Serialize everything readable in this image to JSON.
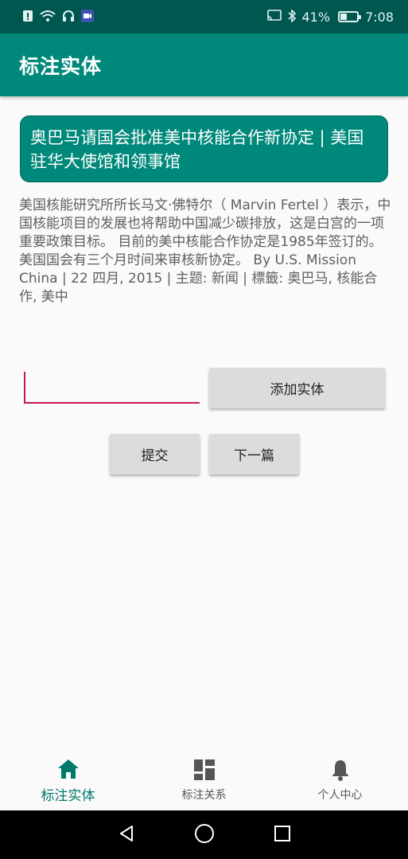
{
  "status_bar": {
    "battery_percent_text": "41%",
    "battery_level": 0.41,
    "time": "7:08"
  },
  "app_bar": {
    "title": "标注实体"
  },
  "article": {
    "title": "奥巴马请国会批准美中核能合作新协定 | 美国驻华大使馆和领事馆",
    "body": " 美国核能研究所所长马文·佛特尔（ Marvin Fertel ）表示，中国核能项目的发展也将帮助中国减少碳排放，这是白宫的一项重要政策目标。 目前的美中核能合作协定是1985年签订的。美国国会有三个月时间来审核新协定。 By U.S. Mission China | 22 四月, 2015 | 主题: 新闻 | 標籤: 奥巴马, 核能合作, 美中"
  },
  "entity_input": {
    "value": "",
    "placeholder": ""
  },
  "buttons": {
    "add_entity": "添加实体",
    "submit": "提交",
    "next": "下一篇"
  },
  "bottom_nav": {
    "items": [
      {
        "label": "标注实体",
        "icon": "home-icon",
        "active": true
      },
      {
        "label": "标注关系",
        "icon": "dashboard-icon",
        "active": false
      },
      {
        "label": "个人中心",
        "icon": "bell-icon",
        "active": false
      }
    ]
  },
  "colors": {
    "status_bar": "#00574f",
    "primary": "#00897b",
    "accent": "#c2185b",
    "active_nav": "#00796b",
    "inactive_nav": "#555555"
  }
}
